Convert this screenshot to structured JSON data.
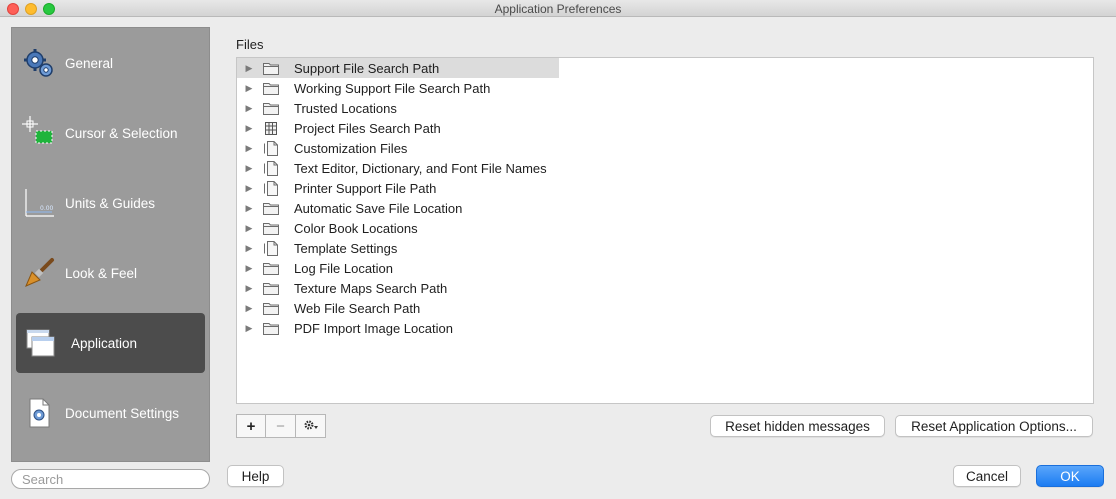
{
  "window": {
    "title": "Application Preferences"
  },
  "sidebar": {
    "items": [
      {
        "label": "General",
        "icon": "gears-icon"
      },
      {
        "label": "Cursor & Selection",
        "icon": "crosshair-selection-icon"
      },
      {
        "label": "Units & Guides",
        "icon": "units-guides-icon"
      },
      {
        "label": "Look & Feel",
        "icon": "paintbrush-icon"
      },
      {
        "label": "Application",
        "icon": "application-windows-icon",
        "selected": true
      },
      {
        "label": "Document Settings",
        "icon": "document-settings-icon"
      }
    ],
    "search": {
      "placeholder": "Search",
      "value": ""
    }
  },
  "files": {
    "label": "Files",
    "items": [
      {
        "label": "Support File Search Path",
        "icon": "folder-icon"
      },
      {
        "label": "Working Support File Search Path",
        "icon": "folder-icon"
      },
      {
        "label": "Trusted Locations",
        "icon": "folder-icon"
      },
      {
        "label": "Project Files Search Path",
        "icon": "project-files-icon"
      },
      {
        "label": "Customization Files",
        "icon": "document-icon"
      },
      {
        "label": "Text Editor, Dictionary, and Font File Names",
        "icon": "document-icon"
      },
      {
        "label": "Printer Support File Path",
        "icon": "document-icon"
      },
      {
        "label": "Automatic Save File Location",
        "icon": "folder-icon"
      },
      {
        "label": "Color Book Locations",
        "icon": "folder-icon"
      },
      {
        "label": "Template Settings",
        "icon": "document-icon"
      },
      {
        "label": "Log File Location",
        "icon": "folder-icon"
      },
      {
        "label": "Texture Maps Search Path",
        "icon": "folder-icon"
      },
      {
        "label": "Web File Search Path",
        "icon": "folder-icon"
      },
      {
        "label": "PDF Import Image Location",
        "icon": "folder-icon"
      }
    ]
  },
  "toolbar": {
    "add": "+",
    "remove": "−",
    "gear": "gear-icon"
  },
  "buttons": {
    "reset_hidden": "Reset hidden messages",
    "reset_app": "Reset Application Options...",
    "help": "Help",
    "cancel": "Cancel",
    "ok": "OK"
  },
  "colors": {
    "accent": "#1c7cf2",
    "sidebar_bg": "#9b9b9b",
    "sidebar_selected": "#4c4c4c"
  }
}
